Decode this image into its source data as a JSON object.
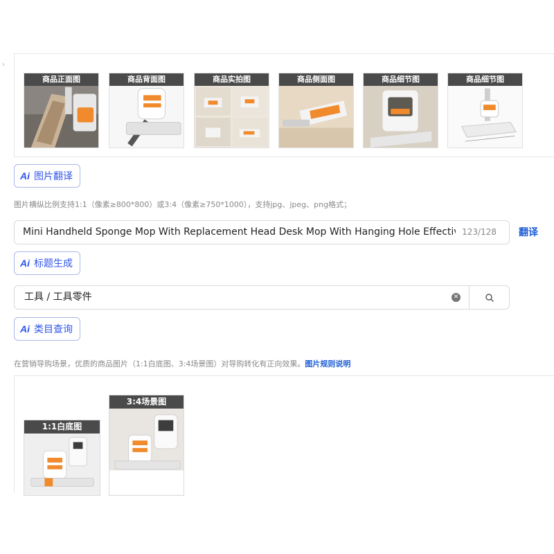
{
  "gallery": {
    "thumbnails": [
      {
        "label": "商品正面图"
      },
      {
        "label": "商品背面图"
      },
      {
        "label": "商品实拍图"
      },
      {
        "label": "商品侧面图"
      },
      {
        "label": "商品细节图"
      },
      {
        "label": "商品细节图"
      }
    ],
    "ai_translate_button": {
      "logo": "Ai",
      "label": "图片翻译"
    },
    "requirements_hint": "图片横纵比例支持1:1（像素≥800*800）或3:4（像素≥750*1000），支持jpg、jpeg、png格式；"
  },
  "title_field": {
    "value": "Mini Handheld Sponge Mop With Replacement Head Desk Mop With Hanging Hole Effectiv",
    "char_count": "123/128",
    "translate_link": "翻译",
    "ai_generate_button": {
      "logo": "Ai",
      "label": "标题生成"
    }
  },
  "category_field": {
    "value": "工具 / 工具零件",
    "clear_icon": "clear-icon",
    "search_icon": "search-icon",
    "ai_lookup_button": {
      "logo": "Ai",
      "label": "类目查询"
    }
  },
  "marketing": {
    "hint": "在营销导购场景，优质的商品图片（1:1白底图、3:4场景图）对导购转化有正向效果。",
    "rules_link": "图片规则说明",
    "cards": [
      {
        "label": "1:1白底图"
      },
      {
        "label": "3:4场景图"
      }
    ]
  },
  "colors": {
    "accent": "#2f54eb",
    "link": "#1f5fd6",
    "product_orange": "#f08a2c",
    "label_bg": "#4a4a4a"
  }
}
